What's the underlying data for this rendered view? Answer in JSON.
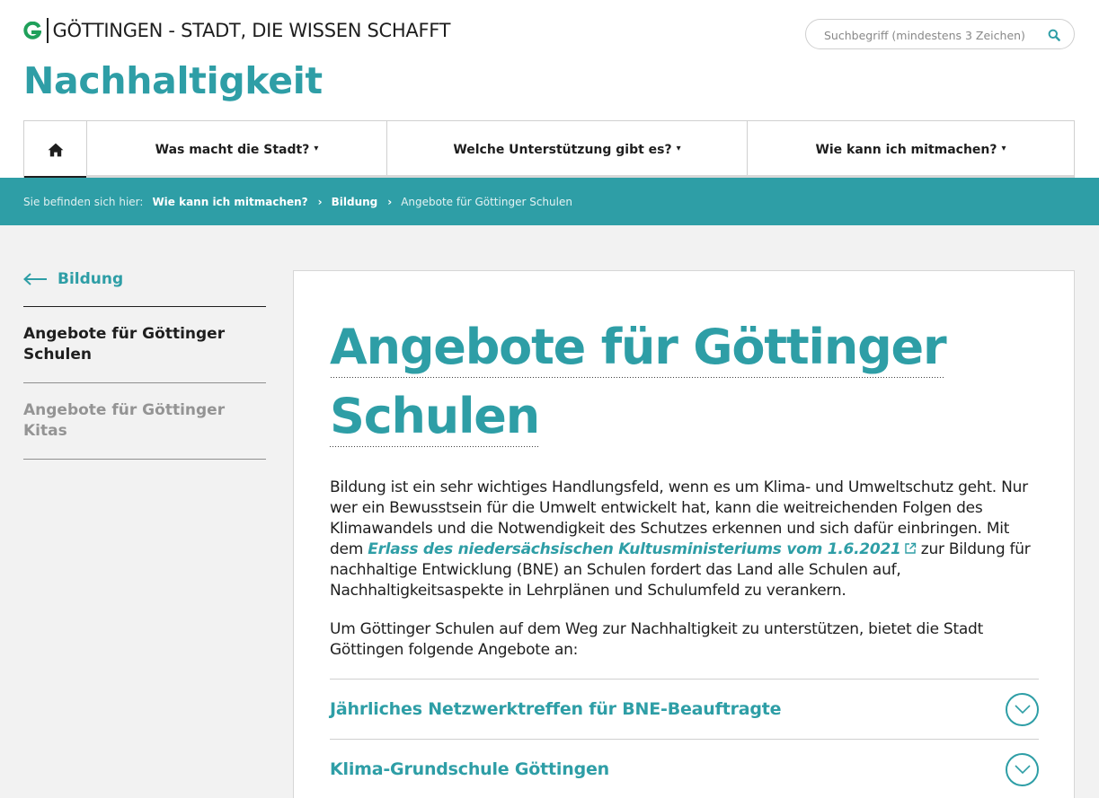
{
  "header": {
    "logo_text": "GÖTTINGEN - STADT, DIE WISSEN SCHAFFT",
    "logo_alt": "G",
    "search_placeholder": "Suchbegriff (mindestens 3 Zeichen)",
    "site_title": "Nachhaltigkeit",
    "brand_color": "#2e9ea6"
  },
  "nav": {
    "home_icon": "home-icon",
    "items": [
      {
        "label": "Was macht die Stadt?",
        "caret": "▾"
      },
      {
        "label": "Welche Unterstützung gibt es?",
        "caret": "▾"
      },
      {
        "label": "Wie kann ich mitmachen?",
        "caret": "▾"
      }
    ]
  },
  "breadcrumb": {
    "intro": "Sie befinden sich hier:",
    "items": [
      "Wie kann ich mitmachen?",
      "Bildung"
    ],
    "separator": "›",
    "current": "Angebote für Göttinger Schulen"
  },
  "sidebar": {
    "back_label": "Bildung",
    "items": [
      {
        "label": "Angebote für Göttinger Schulen",
        "active": true
      },
      {
        "label": "Angebote für Göttinger Kitas",
        "active": false
      }
    ]
  },
  "main": {
    "title": "Angebote für Göttinger Schulen",
    "para1_before": "Bildung ist ein sehr wichtiges Handlungsfeld, wenn es um Klima- und Umweltschutz geht. Nur wer ein Bewusstsein für die Umwelt entwickelt hat, kann die weitreichenden Folgen des Klimawandels und die Notwendigkeit des Schutzes erkennen und sich da­für einbringen. Mit dem ",
    "para1_link": "Erlass des niedersächsischen Kultusministeriums vom 1.6.2021",
    "para1_after": " zur Bildung für nachhaltige Entwicklung (BNE) an Schulen fordert das Land alle Schulen auf, Nachhaltigkeitsaspekte in Lehrplänen und Schulumfeld zu verankern.",
    "para2": "Um Göttinger Schulen auf dem Weg zur Nachhaltigkeit zu unterstützen, bietet die Stadt Göttingen folgende Angebote an:",
    "accordion": [
      {
        "title": "Jährliches Netzwerktreffen für BNE-Beauftragte"
      },
      {
        "title": "Klima-Grundschule Göttingen"
      }
    ]
  }
}
